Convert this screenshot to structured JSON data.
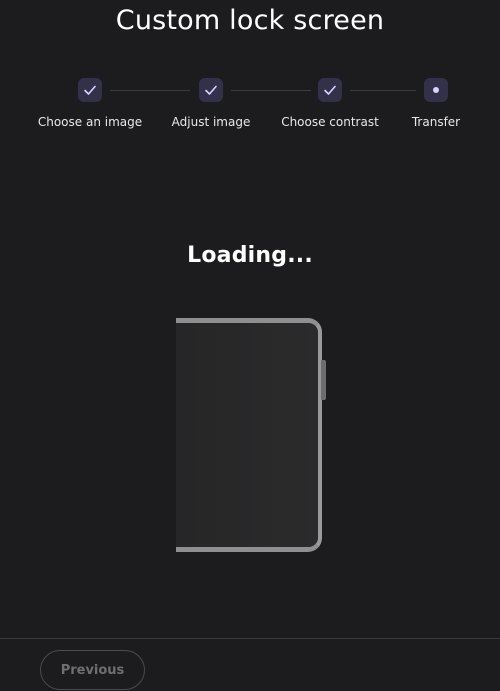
{
  "header": {
    "title": "Custom lock screen"
  },
  "stepper": {
    "steps": [
      {
        "label": "Choose an image",
        "status": "complete",
        "icon": "check-icon"
      },
      {
        "label": "Adjust image",
        "status": "complete",
        "icon": "check-icon"
      },
      {
        "label": "Choose contrast",
        "status": "complete",
        "icon": "check-icon"
      },
      {
        "label": "Transfer",
        "status": "current",
        "icon": "dot-icon"
      }
    ]
  },
  "main": {
    "status_text": "Loading..."
  },
  "footer": {
    "previous_label": "Previous"
  },
  "colors": {
    "background": "#1c1c1e",
    "step_badge": "#33304a",
    "accent": "#d8d4ff",
    "disabled_text": "#6e6e73"
  }
}
